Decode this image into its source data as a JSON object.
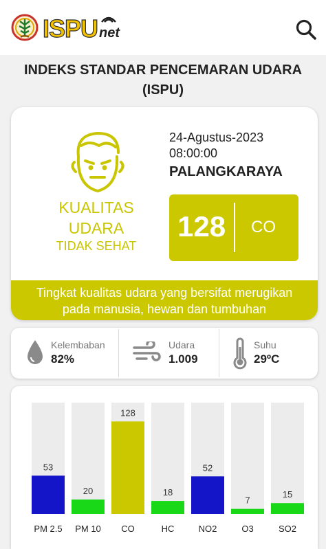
{
  "header": {
    "logo_text": "ISPU",
    "logo_suffix": "net",
    "search_icon": "search-icon"
  },
  "page": {
    "title_line1": "INDEKS STANDAR PENCEMARAN UDARA",
    "title_line2": "(ISPU)"
  },
  "summary": {
    "face_icon": "unhappy-face-icon",
    "quality_line1": "KUALITAS",
    "quality_line2": "UDARA",
    "status": "TIDAK SEHAT",
    "date": "24-Agustus-2023",
    "time": "08:00:00",
    "city": "PALANGKARAYA",
    "index_value": "128",
    "index_parameter": "CO",
    "description_line1": "Tingkat kualitas udara yang bersifat merugikan",
    "description_line2": "pada manusia, hewan dan tumbuhan",
    "status_color": "#cbc800"
  },
  "stats": [
    {
      "label": "Kelembaban",
      "value": "82%",
      "icon": "water-drop-icon"
    },
    {
      "label": "Udara",
      "value": "1.009",
      "icon": "wind-icon"
    },
    {
      "label": "Suhu",
      "value": "29ºC",
      "icon": "thermometer-icon"
    }
  ],
  "colors": {
    "good": "#18d818",
    "moderate": "#1414c8",
    "unhealthy": "#cbc800",
    "track": "#ececec"
  },
  "chart_data": {
    "type": "bar",
    "categories": [
      "PM 2.5",
      "PM 10",
      "CO",
      "HC",
      "NO2",
      "O3",
      "SO2"
    ],
    "values": [
      53,
      20,
      128,
      18,
      52,
      7,
      15
    ],
    "bar_colors": [
      "#1414c8",
      "#18d818",
      "#cbc800",
      "#18d818",
      "#1414c8",
      "#18d818",
      "#18d818"
    ],
    "ylim": [
      0,
      135
    ],
    "title": "",
    "xlabel": "",
    "ylabel": ""
  }
}
